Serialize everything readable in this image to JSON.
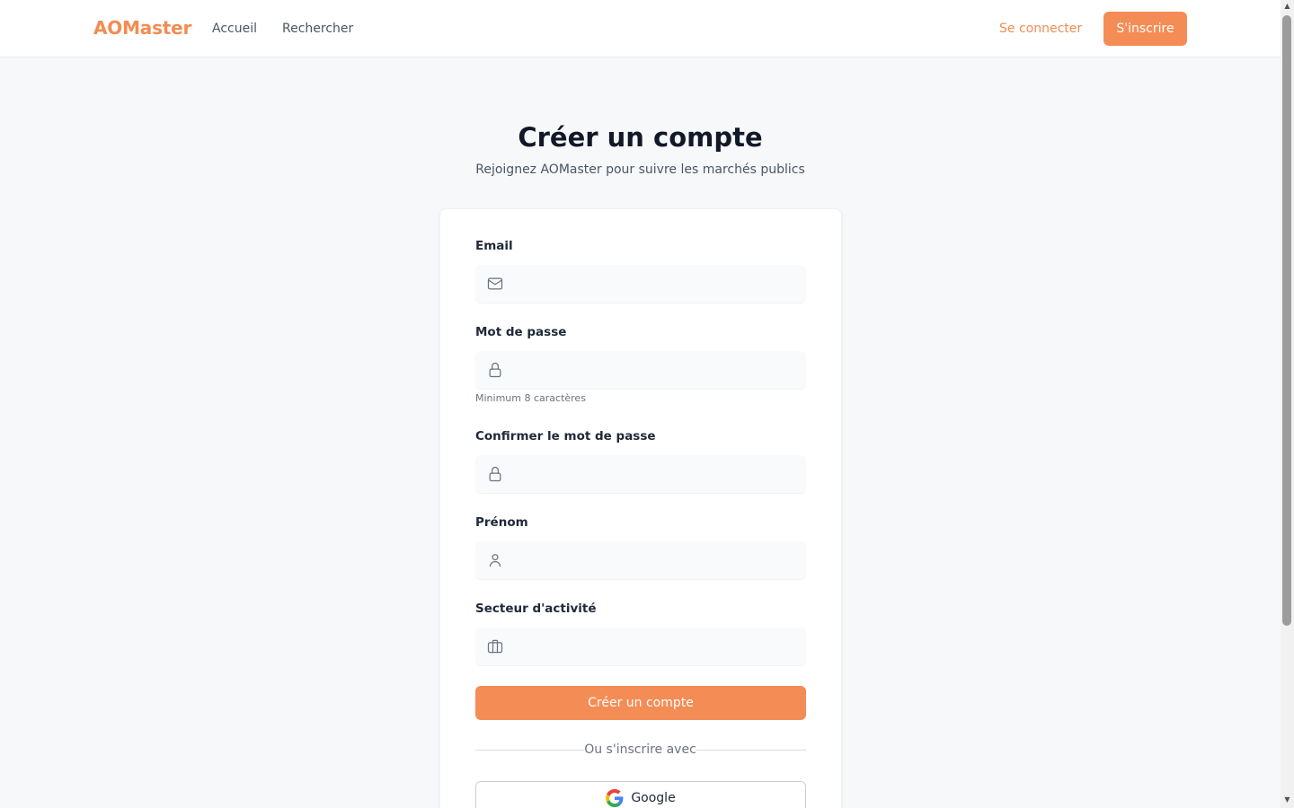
{
  "navbar": {
    "brand": "AOMaster",
    "links": [
      "Accueil",
      "Rechercher"
    ],
    "login": "Se connecter",
    "signup": "S'inscrire"
  },
  "main": {
    "title": "Créer un compte",
    "subtitle": "Rejoignez AOMaster pour suivre les marchés publics"
  },
  "form": {
    "email": {
      "label": "Email",
      "value": "",
      "placeholder": "",
      "icon": "mail-icon"
    },
    "password": {
      "label": "Mot de passe",
      "value": "",
      "placeholder": "",
      "icon": "lock-icon",
      "hint": "Minimum 8 caractères"
    },
    "confirm_password": {
      "label": "Confirmer le mot de passe",
      "value": "",
      "placeholder": "",
      "icon": "lock-icon"
    },
    "first_name": {
      "label": "Prénom",
      "value": "",
      "placeholder": "",
      "icon": "user-icon"
    },
    "sector": {
      "label": "Secteur d'activité",
      "value": "",
      "placeholder": "",
      "icon": "briefcase-icon"
    },
    "submit": "Créer un compte",
    "divider": "Ou s'inscrire avec",
    "google": "Google"
  },
  "colors": {
    "accent": "#f48c55",
    "brand": "#f28c52",
    "background": "#f7f8fa"
  }
}
